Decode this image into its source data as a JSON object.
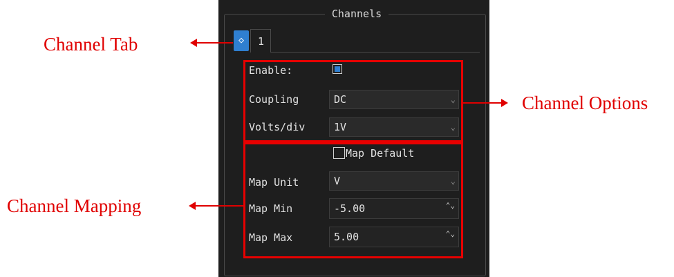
{
  "group": {
    "title": "Channels"
  },
  "tabs": {
    "icon": "chevrons-icon",
    "icon_glyph": "◇",
    "active_label": "1"
  },
  "options": {
    "enable_label": "Enable:",
    "enable_checked": true,
    "coupling_label": "Coupling",
    "coupling_value": "DC",
    "volts_label": "Volts/div",
    "volts_value": "1V"
  },
  "mapping": {
    "map_default_label": "Map Default",
    "map_default_checked": false,
    "unit_label": "Map Unit",
    "unit_value": "V",
    "min_label": "Map Min",
    "min_value": "-5.00",
    "max_label": "Map Max",
    "max_value": "5.00"
  },
  "annotations": {
    "channel_tab": "Channel Tab",
    "channel_options": "Channel Options",
    "channel_mapping": "Channel Mapping"
  },
  "glyphs": {
    "dropdown": "⌄",
    "spin": "⌃⌄"
  },
  "colors": {
    "accent": "#2f7fd0",
    "panel_bg": "#1e1e1e",
    "annotation_red": "#e00000"
  }
}
